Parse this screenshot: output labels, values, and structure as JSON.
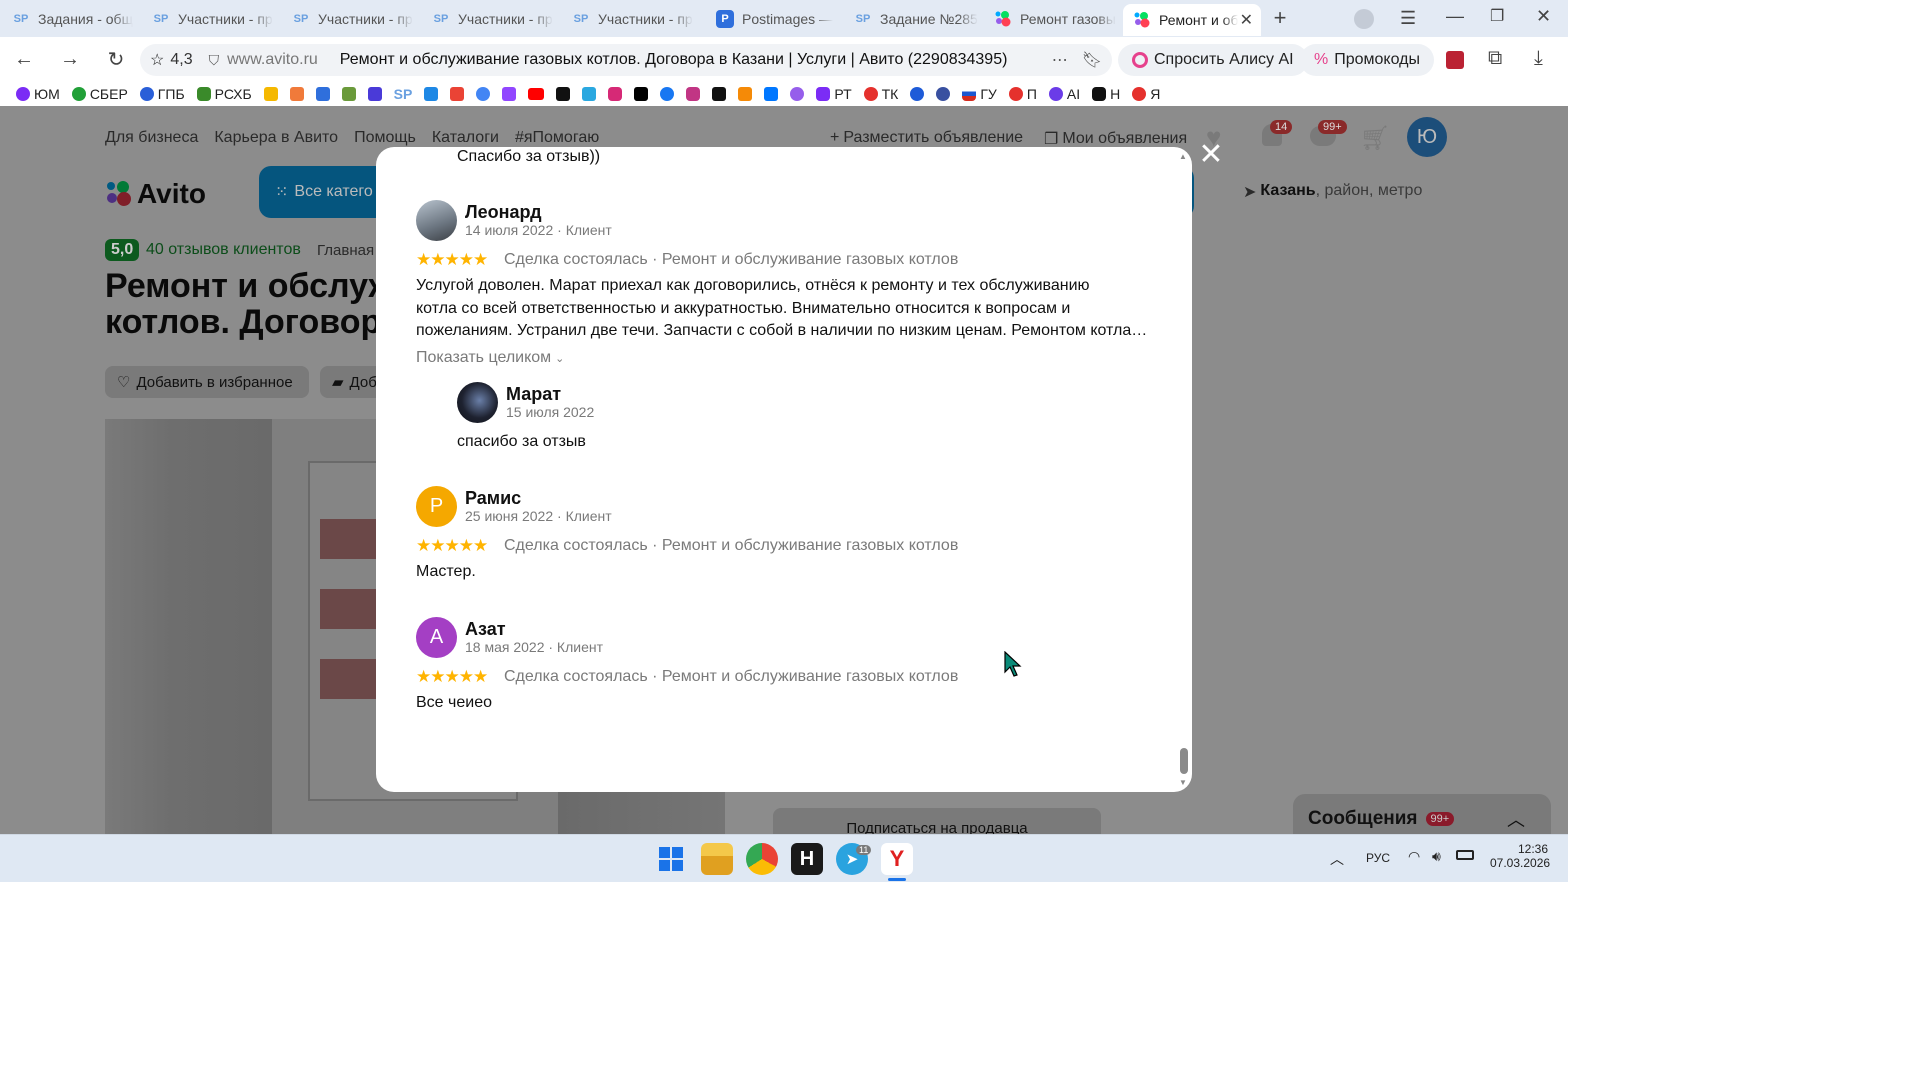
{
  "tabs": [
    {
      "icon": "SP",
      "title": "Задания - общ"
    },
    {
      "icon": "SP",
      "title": "Участники - пр"
    },
    {
      "icon": "SP",
      "title": "Участники - пр"
    },
    {
      "icon": "SP",
      "title": "Участники - пр"
    },
    {
      "icon": "SP",
      "title": "Участники - пр"
    },
    {
      "icon": "P",
      "title": "Postimages — "
    },
    {
      "icon": "SP",
      "title": "Задание №285"
    },
    {
      "icon": "",
      "title": "Ремонт газовы"
    },
    {
      "icon": "",
      "title": "Ремонт и об"
    }
  ],
  "address": {
    "rating": "4,3",
    "domain": "www.avito.ru",
    "page_title": "Ремонт и обслуживание газовых котлов. Договора в Казани | Услуги | Авито (2290834395)",
    "alice": "Спросить Алису AI",
    "promo": "Промокоды"
  },
  "bookmarks": [
    "ЮМ",
    "СБЕР",
    "ГПБ",
    "РСХБ",
    "РТ",
    "ТК",
    "ГУ",
    "П",
    "AI",
    "Н",
    "Я"
  ],
  "avito": {
    "nav": [
      "Для бизнеса",
      "Карьера в Авито",
      "Помощь",
      "Каталоги",
      "#яПомогаю"
    ],
    "post_ad": "Разместить объявление",
    "my_ads": "Мои объявления",
    "notif_count": "14",
    "msg_count": "99+",
    "avatar_letter": "Ю",
    "logo": "Avito",
    "all_categories": "Все катего",
    "location_city": "Казань",
    "location_rest": ", район, метро",
    "rating_badge": "5,0",
    "reviews_link": "40 отзывов клиентов",
    "breadcrumb": "Главная",
    "title_line1": "Ремонт и обслуж",
    "title_line2": "котлов. Договор",
    "fav_button": "Добавить в избранное",
    "note_button": "Доб",
    "subscribe": "Подписаться на продавца",
    "messages": "Сообщения",
    "messages_badge": "99+"
  },
  "reviews_modal": {
    "top_text": "Спасибо за отзыв))",
    "items": [
      {
        "author": "Леонард",
        "meta": "14 июля 2022 · Клиент",
        "deal": "Сделка состоялась · Ремонт и обслуживание газовых котлов",
        "text_lines": [
          "Услугой доволен. Марат приехал как договорились, отнёся к ремонту и тех обслуживанию",
          "котла со всей ответственностью и аккуратностью. Внимательно относится к вопросам и",
          "пожеланиям. Устранил две течи. Запчасти с собой в наличии по низким ценам. Ремонтом котла…"
        ],
        "show_more": "Показать целиком",
        "reply": {
          "author": "Марат",
          "date": "15 июля 2022",
          "text": "спасибо за отзыв"
        }
      },
      {
        "author": "Рамис",
        "letter": "Р",
        "avatar_color": "#f5a800",
        "meta": "25 июня 2022 · Клиент",
        "deal": "Сделка состоялась · Ремонт и обслуживание газовых котлов",
        "text": "Мастер."
      },
      {
        "author": "Азат",
        "letter": "А",
        "avatar_color": "#a43fc4",
        "meta": "18 мая 2022 · Клиент",
        "deal": "Сделка состоялась · Ремонт и обслуживание газовых котлов",
        "text": "Все чеиео"
      }
    ],
    "stars": "★★★★★"
  },
  "taskbar": {
    "lang": "РУС",
    "time": "12:36",
    "date": "07.03.2026",
    "telegram_badge": "11"
  }
}
